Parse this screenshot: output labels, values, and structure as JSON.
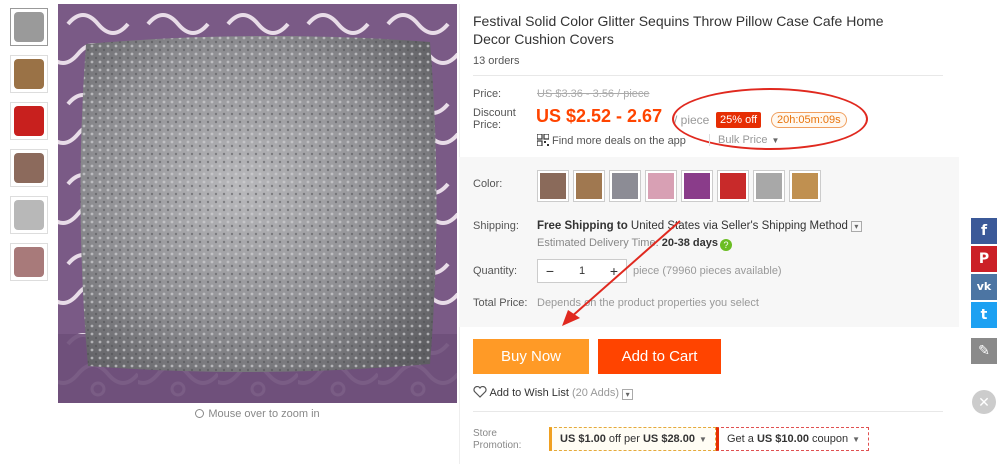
{
  "product": {
    "title": "Festival Solid Color Glitter Sequins Throw Pillow Case Cafe Home Decor Cushion Covers",
    "orders": "13 orders"
  },
  "gallery": {
    "zoom_hint": "Mouse over to zoom in",
    "thumb_colors": [
      "#9a9a9a",
      "#9a7246",
      "#c8201e",
      "#8c6a5c",
      "#b8b8b8",
      "#a87a7a"
    ]
  },
  "price": {
    "label": "Price:",
    "original": "US $3.36 - 3.56 / piece",
    "discount_label_1": "Discount",
    "discount_label_2": "Price:",
    "discount": "US $2.52 - 2.67",
    "unit": "/ piece",
    "off_badge": "25% off",
    "timer": "20h:05m:09s",
    "app_deals": "Find more deals on the app",
    "bulk": "Bulk Price"
  },
  "color": {
    "label": "Color:",
    "swatches": [
      "#8a6a5a",
      "#a07850",
      "#8c8c95",
      "#d8a0b4",
      "#8a3c8a",
      "#c82a2a",
      "#a8a8a8",
      "#c09050"
    ]
  },
  "shipping": {
    "label": "Shipping:",
    "main_bold": "Free Shipping to",
    "main_rest": " United States via Seller's Shipping Method",
    "est_label": "Estimated Delivery Time: ",
    "est_value": "20-38 days"
  },
  "quantity": {
    "label": "Quantity:",
    "value": "1",
    "minus": "−",
    "plus": "+",
    "available": "piece (79960 pieces available)"
  },
  "total": {
    "label": "Total Price:",
    "value": "Depends on the product properties you select"
  },
  "actions": {
    "buy_now": "Buy Now",
    "add_to_cart": "Add to Cart",
    "wishlist": "Add to Wish List",
    "wishlist_count": "(20 Adds)"
  },
  "store": {
    "label_1": "Store",
    "label_2": "Promotion:",
    "promo1_a": "US $1.00",
    "promo1_b": " off per ",
    "promo1_c": "US $28.00",
    "promo2_a": "Get a ",
    "promo2_b": "US $10.00",
    "promo2_c": " coupon"
  },
  "social": {
    "facebook": "f",
    "pinterest": "P",
    "vk": "vk",
    "twitter": "t",
    "edit": "✎",
    "close": "✕"
  },
  "colors": {
    "accent_orange": "#ff4400",
    "buy_now_orange": "#ff9a26",
    "annotation_red": "#e0291f"
  }
}
